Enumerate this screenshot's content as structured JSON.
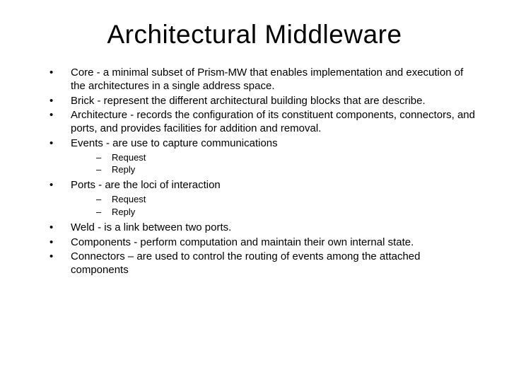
{
  "title": "Architectural Middleware",
  "bullets": [
    {
      "text": "Core - a minimal subset of Prism-MW that enables implementation and execution of the architectures in a single address space."
    },
    {
      "text": "Brick - represent the different architectural building blocks that are describe."
    },
    {
      "text": "Architecture - records the configuration of its constituent components, connectors, and ports, and provides facilities for addition and removal."
    },
    {
      "text": "Events - are use to capture communications",
      "sub": [
        "Request",
        "Reply"
      ]
    },
    {
      "text": "Ports - are the loci of interaction",
      "sub": [
        "Request",
        "Reply"
      ]
    },
    {
      "text": "Weld - is a link between two ports."
    },
    {
      "text": "Components - perform computation and maintain their own internal state."
    },
    {
      "text": "Connectors – are used to control the routing of events among the attached components"
    }
  ]
}
